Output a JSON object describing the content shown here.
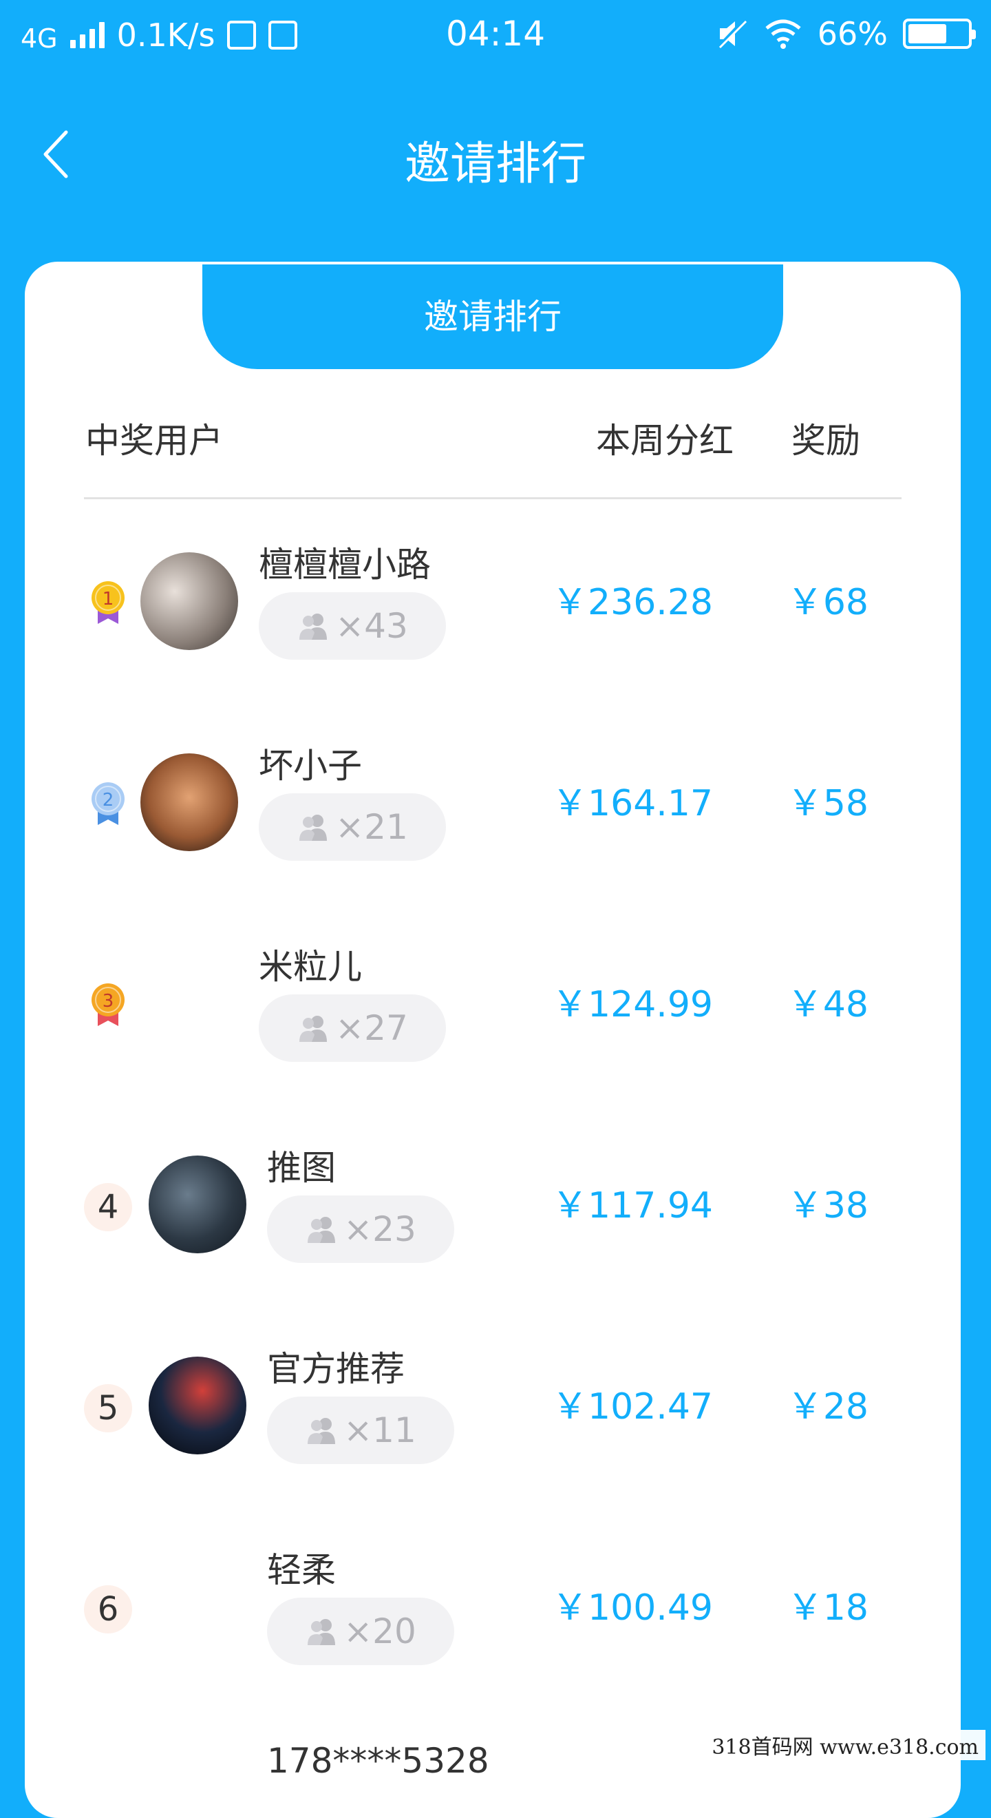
{
  "status_bar": {
    "network": "4G",
    "speed": "0.1K/s",
    "time": "04:14",
    "battery_pct": "66%",
    "battery_level": 0.66
  },
  "header": {
    "title": "邀请排行"
  },
  "tab": {
    "label": "邀请排行"
  },
  "columns": {
    "user": "中奖用户",
    "dividend": "本周分红",
    "reward": "奖励"
  },
  "rows": [
    {
      "rank": "1",
      "medal": "gold",
      "name": "檀檀檀小路",
      "invites": "×43",
      "dividend": "￥236.28",
      "reward": "￥68",
      "has_avatar": true
    },
    {
      "rank": "2",
      "medal": "silver",
      "name": "坏小子",
      "invites": "×21",
      "dividend": "￥164.17",
      "reward": "￥58",
      "has_avatar": true
    },
    {
      "rank": "3",
      "medal": "bronze",
      "name": "米粒儿",
      "invites": "×27",
      "dividend": "￥124.99",
      "reward": "￥48",
      "has_avatar": false
    },
    {
      "rank": "4",
      "medal": "",
      "name": "推图",
      "invites": "×23",
      "dividend": "￥117.94",
      "reward": "￥38",
      "has_avatar": true
    },
    {
      "rank": "5",
      "medal": "",
      "name": "官方推荐",
      "invites": "×11",
      "dividend": "￥102.47",
      "reward": "￥28",
      "has_avatar": true
    },
    {
      "rank": "6",
      "medal": "",
      "name": "轻柔",
      "invites": "×20",
      "dividend": "￥100.49",
      "reward": "￥18",
      "has_avatar": false
    }
  ],
  "next_row_partial": {
    "name": "178****5328"
  },
  "watermark": "318首码网   www.e318.com",
  "colors": {
    "accent": "#12aefb",
    "pill_bg": "#f2f2f4",
    "rank_bg": "#fdf0ea",
    "gold": "#f7c21d",
    "silver": "#a9ccf5",
    "bronze": "#f5a623"
  }
}
